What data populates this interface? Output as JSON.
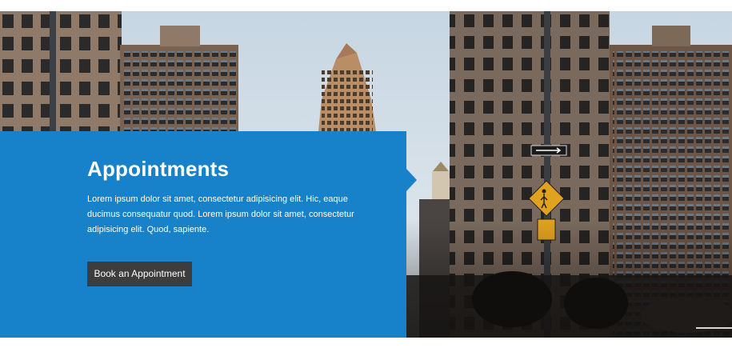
{
  "section": {
    "title": "Appointments",
    "body": "Lorem ipsum dolor sit amet, consectetur adipisicing elit. Hic, eaque ducimus consequatur quod. Lorem ipsum dolor sit amet, consectetur adipisicing elit. Quod, sapiente.",
    "button_label": "Book an Appointment"
  },
  "colors": {
    "panel_blue": "#1781c9",
    "button_dark": "#3d3d3d",
    "sky": "#c9d7e4"
  },
  "icons": [
    "walking-pedestrian-sign-icon",
    "one-way-arrow-sign-icon"
  ]
}
